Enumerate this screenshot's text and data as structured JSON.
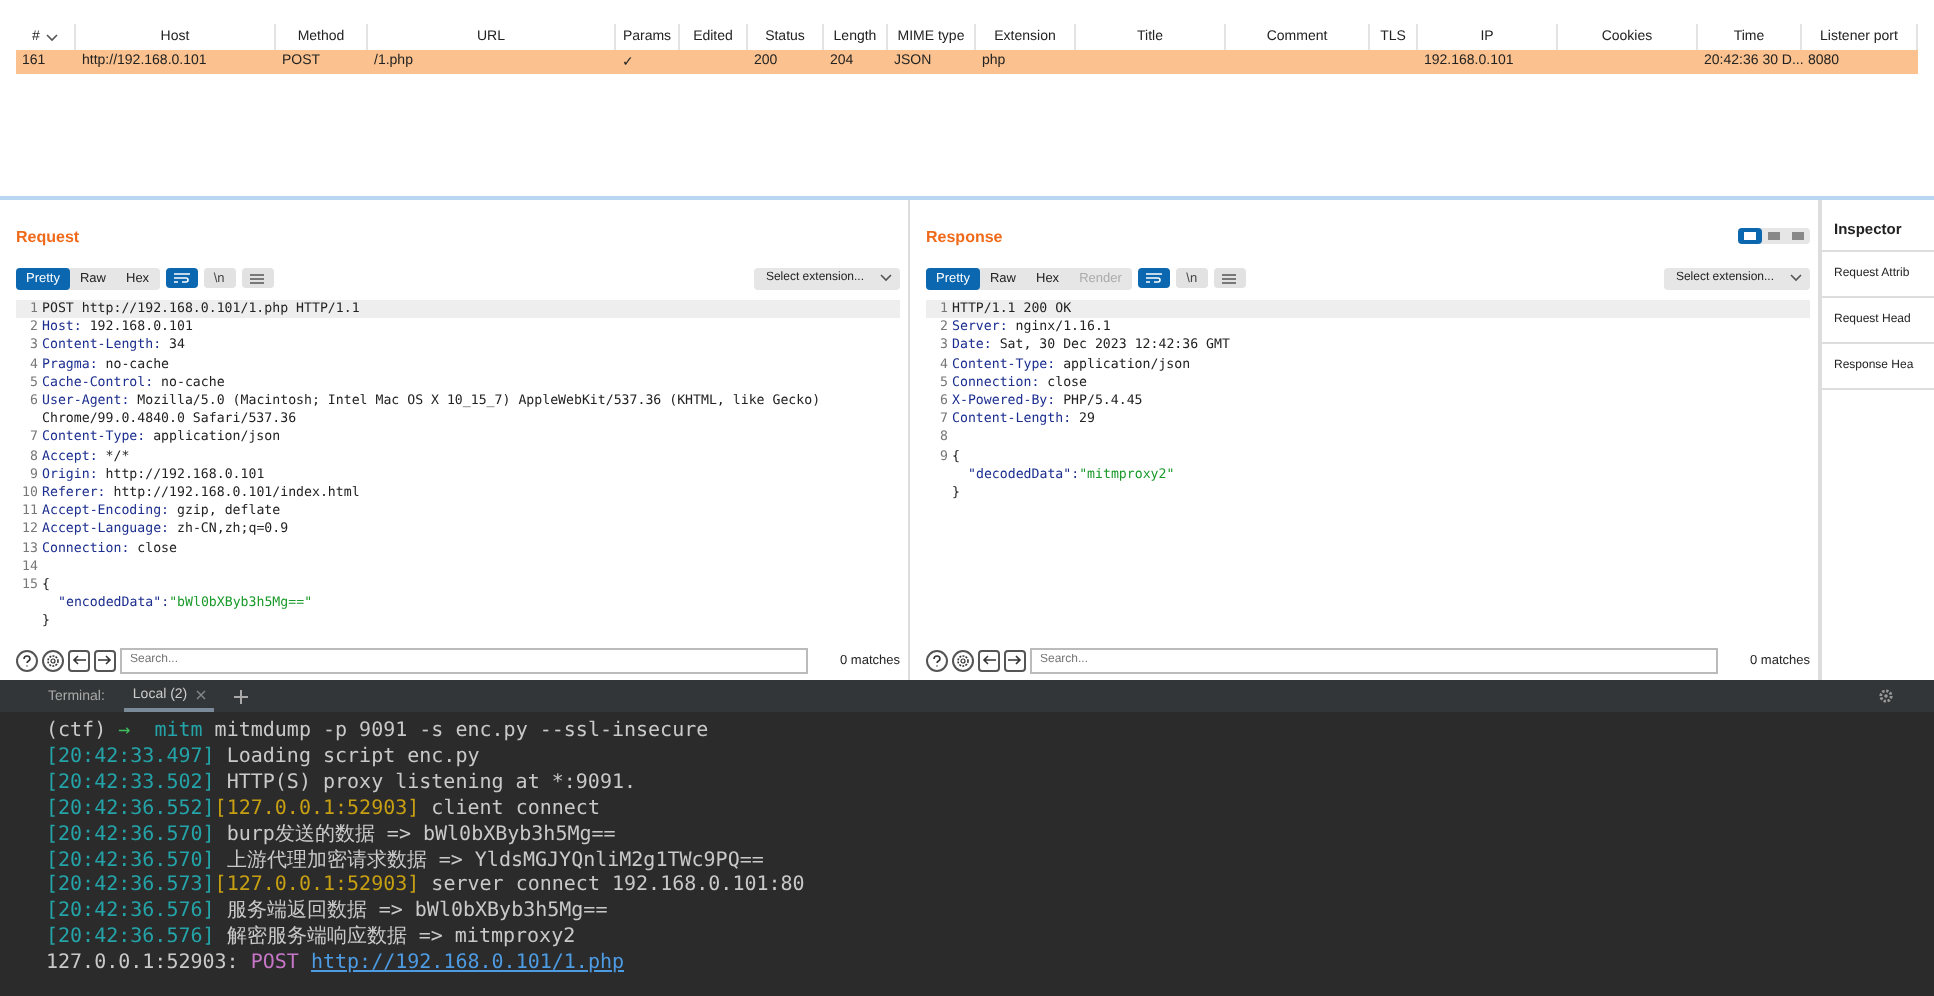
{
  "table": {
    "columns": [
      "#",
      "Host",
      "Method",
      "URL",
      "Params",
      "Edited",
      "Status",
      "Length",
      "MIME type",
      "Extension",
      "Title",
      "Comment",
      "TLS",
      "IP",
      "Cookies",
      "Time",
      "Listener port"
    ],
    "rows": [
      {
        "selected": true,
        "cells": [
          "161",
          "http://192.168.0.101",
          "POST",
          "/1.php",
          "✓",
          "",
          "200",
          "204",
          "JSON",
          "php",
          "",
          "",
          "",
          "192.168.0.101",
          "",
          "20:42:36 30 D...",
          "8080"
        ]
      }
    ]
  },
  "request": {
    "title": "Request",
    "tabs": [
      {
        "label": "Pretty",
        "selected": true,
        "disabled": false
      },
      {
        "label": "Raw",
        "selected": false,
        "disabled": false
      },
      {
        "label": "Hex",
        "selected": false,
        "disabled": false
      }
    ],
    "tools": [
      {
        "kind": "wrap",
        "selected": true
      },
      {
        "kind": "newline",
        "label": "\\n",
        "selected": false
      },
      {
        "kind": "menu",
        "selected": false
      }
    ],
    "extension": "Select extension...",
    "lines": [
      {
        "number": "1",
        "kind": "plain",
        "text": "POST http://192.168.0.101/1.php HTTP/1.1"
      },
      {
        "number": "2",
        "kind": "header",
        "name": "Host:",
        "value": " 192.168.0.101"
      },
      {
        "number": "3",
        "kind": "header",
        "name": "Content-Length:",
        "value": " 34"
      },
      {
        "number": "4",
        "kind": "header",
        "name": "Pragma:",
        "value": " no-cache"
      },
      {
        "number": "5",
        "kind": "header",
        "name": "Cache-Control:",
        "value": " no-cache"
      },
      {
        "number": "6",
        "kind": "header",
        "name": "User-Agent:",
        "value": " Mozilla/5.0 (Macintosh; Intel Mac OS X 10_15_7) AppleWebKit/537.36 (KHTML, like Gecko) Chrome/99.0.4840.0 Safari/537.36"
      },
      {
        "number": "7",
        "kind": "header",
        "name": "Content-Type:",
        "value": " application/json"
      },
      {
        "number": "8",
        "kind": "header",
        "name": "Accept:",
        "value": " */*"
      },
      {
        "number": "9",
        "kind": "header",
        "name": "Origin:",
        "value": " http://192.168.0.101"
      },
      {
        "number": "10",
        "kind": "header",
        "name": "Referer:",
        "value": " http://192.168.0.101/index.html"
      },
      {
        "number": "11",
        "kind": "header",
        "name": "Accept-Encoding:",
        "value": " gzip, deflate"
      },
      {
        "number": "12",
        "kind": "header",
        "name": "Accept-Language:",
        "value": " zh-CN,zh;q=0.9"
      },
      {
        "number": "13",
        "kind": "header",
        "name": "Connection:",
        "value": " close"
      },
      {
        "number": "14",
        "kind": "blank"
      },
      {
        "number": "15",
        "kind": "plain",
        "text": "{"
      },
      {
        "kind": "json",
        "name": "\"encodedData\":",
        "value": "\"bWl0bXByb3h5Mg==\""
      },
      {
        "kind": "plain",
        "text": "}"
      }
    ],
    "search": {
      "placeholder": "Search...",
      "matches": "0 matches"
    }
  },
  "response": {
    "title": "Response",
    "layout_buttons": [
      {
        "selected": true
      },
      {
        "selected": false
      },
      {
        "selected": false
      }
    ],
    "tabs": [
      {
        "label": "Pretty",
        "selected": true,
        "disabled": false
      },
      {
        "label": "Raw",
        "selected": false,
        "disabled": false
      },
      {
        "label": "Hex",
        "selected": false,
        "disabled": false
      },
      {
        "label": "Render",
        "selected": false,
        "disabled": true
      }
    ],
    "tools": [
      {
        "kind": "wrap",
        "selected": true
      },
      {
        "kind": "newline",
        "label": "\\n",
        "selected": false
      },
      {
        "kind": "menu",
        "selected": false
      }
    ],
    "extension": "Select extension...",
    "lines": [
      {
        "number": "1",
        "kind": "plain",
        "text": "HTTP/1.1 200 OK"
      },
      {
        "number": "2",
        "kind": "header",
        "name": "Server:",
        "value": " nginx/1.16.1"
      },
      {
        "number": "3",
        "kind": "header",
        "name": "Date:",
        "value": " Sat, 30 Dec 2023 12:42:36 GMT"
      },
      {
        "number": "4",
        "kind": "header",
        "name": "Content-Type:",
        "value": " application/json"
      },
      {
        "number": "5",
        "kind": "header",
        "name": "Connection:",
        "value": " close"
      },
      {
        "number": "6",
        "kind": "header",
        "name": "X-Powered-By:",
        "value": " PHP/5.4.45"
      },
      {
        "number": "7",
        "kind": "header",
        "name": "Content-Length:",
        "value": " 29"
      },
      {
        "number": "8",
        "kind": "blank"
      },
      {
        "number": "9",
        "kind": "plain",
        "text": "{"
      },
      {
        "kind": "json",
        "name": "\"decodedData\":",
        "value": "\"mitmproxy2\""
      },
      {
        "kind": "plain",
        "text": "}"
      }
    ],
    "search": {
      "placeholder": "Search...",
      "matches": "0 matches"
    }
  },
  "inspector": {
    "title": "Inspector",
    "items": [
      "Request Attrib",
      "Request Head",
      "Response Hea"
    ]
  },
  "terminal": {
    "label": "Terminal:",
    "tabs": [
      {
        "label": "Local (2)",
        "selected": true
      }
    ],
    "lines": [
      [
        {
          "kind": "plain",
          "text": "(ctf) "
        },
        {
          "kind": "green",
          "text": "→"
        },
        {
          "kind": "cyan",
          "text": "  mitm"
        },
        {
          "kind": "plain",
          "text": " mitmdump -p 9091 -s enc.py --ssl-insecure"
        }
      ],
      [
        {
          "kind": "cyan",
          "text": "[20:42:33.497]"
        },
        {
          "kind": "plain",
          "text": " Loading script enc.py"
        }
      ],
      [
        {
          "kind": "cyan",
          "text": "[20:42:33.502]"
        },
        {
          "kind": "plain",
          "text": " HTTP(S) proxy listening at *:9091."
        }
      ],
      [
        {
          "kind": "cyan",
          "text": "[20:42:36.552]"
        },
        {
          "kind": "yellow",
          "text": "[127.0.0.1:52903]"
        },
        {
          "kind": "plain",
          "text": " client connect"
        }
      ],
      [
        {
          "kind": "cyan",
          "text": "[20:42:36.570]"
        },
        {
          "kind": "plain",
          "text": " burp发送的数据 => bWl0bXByb3h5Mg=="
        }
      ],
      [
        {
          "kind": "cyan",
          "text": "[20:42:36.570]"
        },
        {
          "kind": "plain",
          "text": " 上游代理加密请求数据 => YldsMGJYQnliM2g1TWc9PQ=="
        }
      ],
      [
        {
          "kind": "cyan",
          "text": "[20:42:36.573]"
        },
        {
          "kind": "yellow",
          "text": "[127.0.0.1:52903]"
        },
        {
          "kind": "plain",
          "text": " server connect 192.168.0.101:80"
        }
      ],
      [
        {
          "kind": "cyan",
          "text": "[20:42:36.576]"
        },
        {
          "kind": "plain",
          "text": " 服务端返回数据 => bWl0bXByb3h5Mg=="
        }
      ],
      [
        {
          "kind": "cyan",
          "text": "[20:42:36.576]"
        },
        {
          "kind": "plain",
          "text": " 解密服务端响应数据 => mitmproxy2"
        }
      ],
      [
        {
          "kind": "plain",
          "text": "127.0.0.1:52903: "
        },
        {
          "kind": "magenta",
          "text": "POST "
        },
        {
          "kind": "link",
          "text": "http://192.168.0.101/1.php"
        }
      ]
    ]
  }
}
